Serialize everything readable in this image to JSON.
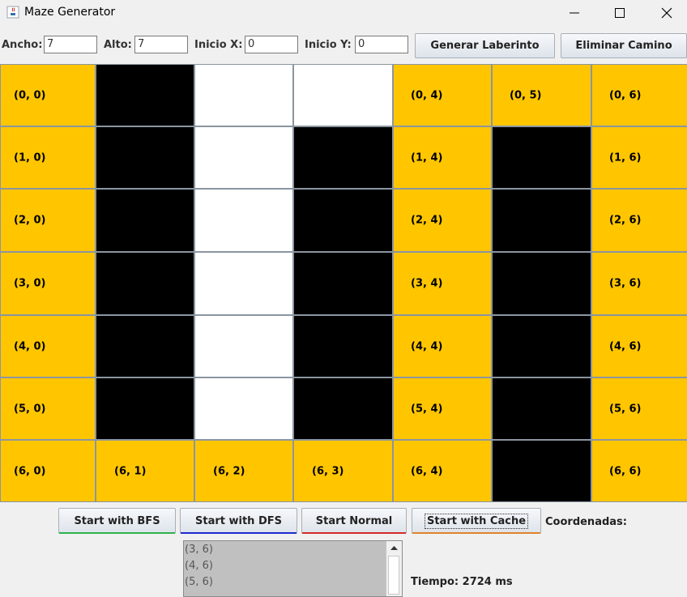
{
  "window": {
    "title": "Maze Generator"
  },
  "controls": {
    "ancho_label": "Ancho:",
    "ancho_value": "7",
    "alto_label": "Alto:",
    "alto_value": "7",
    "inicio_x_label": "Inicio X:",
    "inicio_x_value": "0",
    "inicio_y_label": "Inicio Y:",
    "inicio_y_value": "0",
    "generate_label": "Generar Laberinto",
    "clear_label": "Eliminar Camino"
  },
  "colors": {
    "path": "#ffc600",
    "wall": "#000000",
    "open": "#ffffff"
  },
  "maze": {
    "rows": [
      [
        {
          "t": "path",
          "label": "(0, 0)"
        },
        {
          "t": "wall",
          "label": ""
        },
        {
          "t": "open",
          "label": ""
        },
        {
          "t": "open",
          "label": ""
        },
        {
          "t": "path",
          "label": "(0, 4)"
        },
        {
          "t": "path",
          "label": "(0, 5)"
        },
        {
          "t": "path",
          "label": "(0, 6)"
        }
      ],
      [
        {
          "t": "path",
          "label": "(1, 0)"
        },
        {
          "t": "wall",
          "label": ""
        },
        {
          "t": "open",
          "label": ""
        },
        {
          "t": "wall",
          "label": ""
        },
        {
          "t": "path",
          "label": "(1, 4)"
        },
        {
          "t": "wall",
          "label": ""
        },
        {
          "t": "path",
          "label": "(1, 6)"
        }
      ],
      [
        {
          "t": "path",
          "label": "(2, 0)"
        },
        {
          "t": "wall",
          "label": ""
        },
        {
          "t": "open",
          "label": ""
        },
        {
          "t": "wall",
          "label": ""
        },
        {
          "t": "path",
          "label": "(2, 4)"
        },
        {
          "t": "wall",
          "label": ""
        },
        {
          "t": "path",
          "label": "(2, 6)"
        }
      ],
      [
        {
          "t": "path",
          "label": "(3, 0)"
        },
        {
          "t": "wall",
          "label": ""
        },
        {
          "t": "open",
          "label": ""
        },
        {
          "t": "wall",
          "label": ""
        },
        {
          "t": "path",
          "label": "(3, 4)"
        },
        {
          "t": "wall",
          "label": ""
        },
        {
          "t": "path",
          "label": "(3, 6)"
        }
      ],
      [
        {
          "t": "path",
          "label": "(4, 0)"
        },
        {
          "t": "wall",
          "label": ""
        },
        {
          "t": "open",
          "label": ""
        },
        {
          "t": "wall",
          "label": ""
        },
        {
          "t": "path",
          "label": "(4, 4)"
        },
        {
          "t": "wall",
          "label": ""
        },
        {
          "t": "path",
          "label": "(4, 6)"
        }
      ],
      [
        {
          "t": "path",
          "label": "(5, 0)"
        },
        {
          "t": "wall",
          "label": ""
        },
        {
          "t": "open",
          "label": ""
        },
        {
          "t": "wall",
          "label": ""
        },
        {
          "t": "path",
          "label": "(5, 4)"
        },
        {
          "t": "wall",
          "label": ""
        },
        {
          "t": "path",
          "label": "(5, 6)"
        }
      ],
      [
        {
          "t": "path",
          "label": "(6, 0)"
        },
        {
          "t": "path",
          "label": "(6, 1)"
        },
        {
          "t": "path",
          "label": "(6, 2)"
        },
        {
          "t": "path",
          "label": "(6, 3)"
        },
        {
          "t": "path",
          "label": "(6, 4)"
        },
        {
          "t": "wall",
          "label": ""
        },
        {
          "t": "path",
          "label": "(6, 6)"
        }
      ]
    ]
  },
  "actions": {
    "bfs_label": "Start with BFS",
    "bfs_color": "#2db34a",
    "dfs_label": "Start with DFS",
    "dfs_color": "#1f2bd1",
    "normal_label": "Start Normal",
    "normal_color": "#d42a2a",
    "cache_label": "Start with Cache",
    "cache_color": "#e0832a"
  },
  "coords": {
    "label": "Coordenadas:",
    "items": [
      "(3, 6)",
      "(4, 6)",
      "(5, 6)"
    ]
  },
  "timing": {
    "text": "Tiempo: 2724 ms"
  },
  "icons": {
    "app": "java-icon",
    "minimize": "minimize-icon",
    "maximize": "maximize-icon",
    "close": "close-icon",
    "scroll_up": "scroll-up-arrow-icon"
  }
}
